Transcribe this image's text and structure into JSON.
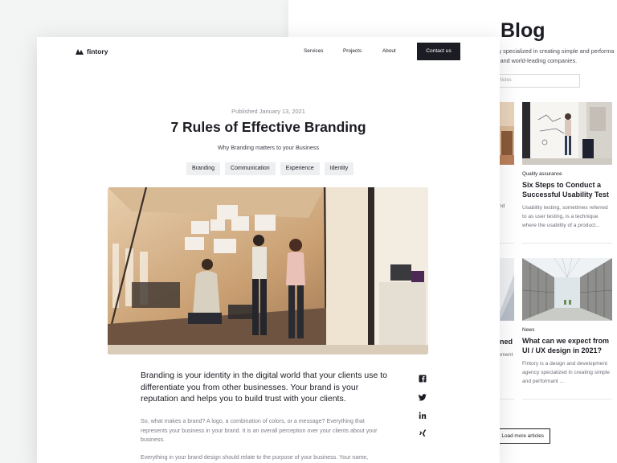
{
  "blog": {
    "title": "Blog",
    "description": "ency specialized in creating simple and performa\nups and world-leading companies.",
    "search_placeholder": "rticles",
    "card1": {
      "category": "Quality assurance",
      "title": "Six Steps to Conduct a Successful Usability Test",
      "excerpt": "Usability testing, sometimes referred to as user testing, is a technique where the usability of a product..."
    },
    "card2": {
      "category": "News",
      "title": "What can we expect from UI / UX design in 2021?",
      "excerpt": "Fintory is a design and development agency specialized in creating simple and performant ..."
    },
    "partial_left_1": "nd",
    "partial_title_2": "ened",
    "partial_left_2": "oment",
    "load_more_label": "Load more articles"
  },
  "article": {
    "logo_text": "fintory",
    "nav": {
      "services": "Services",
      "projects": "Projects",
      "about": "About",
      "contact": "Contact us"
    },
    "published": "Published January 13, 2021",
    "headline": "7 Rules of Effective Branding",
    "subtitle": "Why Branding matters to your Business",
    "tags": [
      "Branding",
      "Communication",
      "Experience",
      "Identity"
    ],
    "lead": "Branding is your identity in the digital world that your clients use to differentiate you from other businesses. Your brand is your reputation and helps you to build trust with your clients.",
    "body1": "So, what makes a brand? A logo, a combination of colors, or a message? Everything that represents your business in your brand. It is an overall perception over your clients about your business.",
    "body2": "Everything in your brand design should relate to the purpose of your business. Your name,"
  },
  "share_icons": [
    "facebook-icon",
    "twitter-icon",
    "linkedin-icon",
    "xing-icon"
  ],
  "colors": {
    "dark": "#1c1d24",
    "tag_bg": "#eeeff1",
    "muted_text": "#7b7d86",
    "page_bg": "#f3f4f4"
  }
}
